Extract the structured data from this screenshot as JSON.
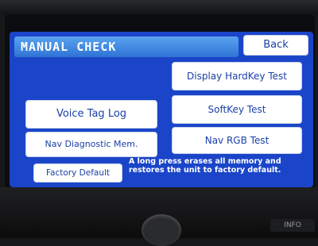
{
  "screen": {
    "title": "MANUAL CHECK",
    "buttons": {
      "back": "Back",
      "display_hardkey_test": "Display HardKey Test",
      "voice_tag_log": "Voice Tag Log",
      "softkey_test": "SoftKey Test",
      "nav_diagnostic_mem": "Nav Diagnostic Mem.",
      "nav_rgb_test": "Nav RGB Test",
      "factory_default": "Factory Default"
    },
    "note": "A long press erases all memory and restores the unit to factory default."
  },
  "hardware": {
    "info_key": "INFO"
  },
  "colors": {
    "screen_background": "#1b45c9",
    "title_bar": "#3a85e0",
    "button_face": "#ffffff",
    "button_text": "#1a3fa8"
  }
}
